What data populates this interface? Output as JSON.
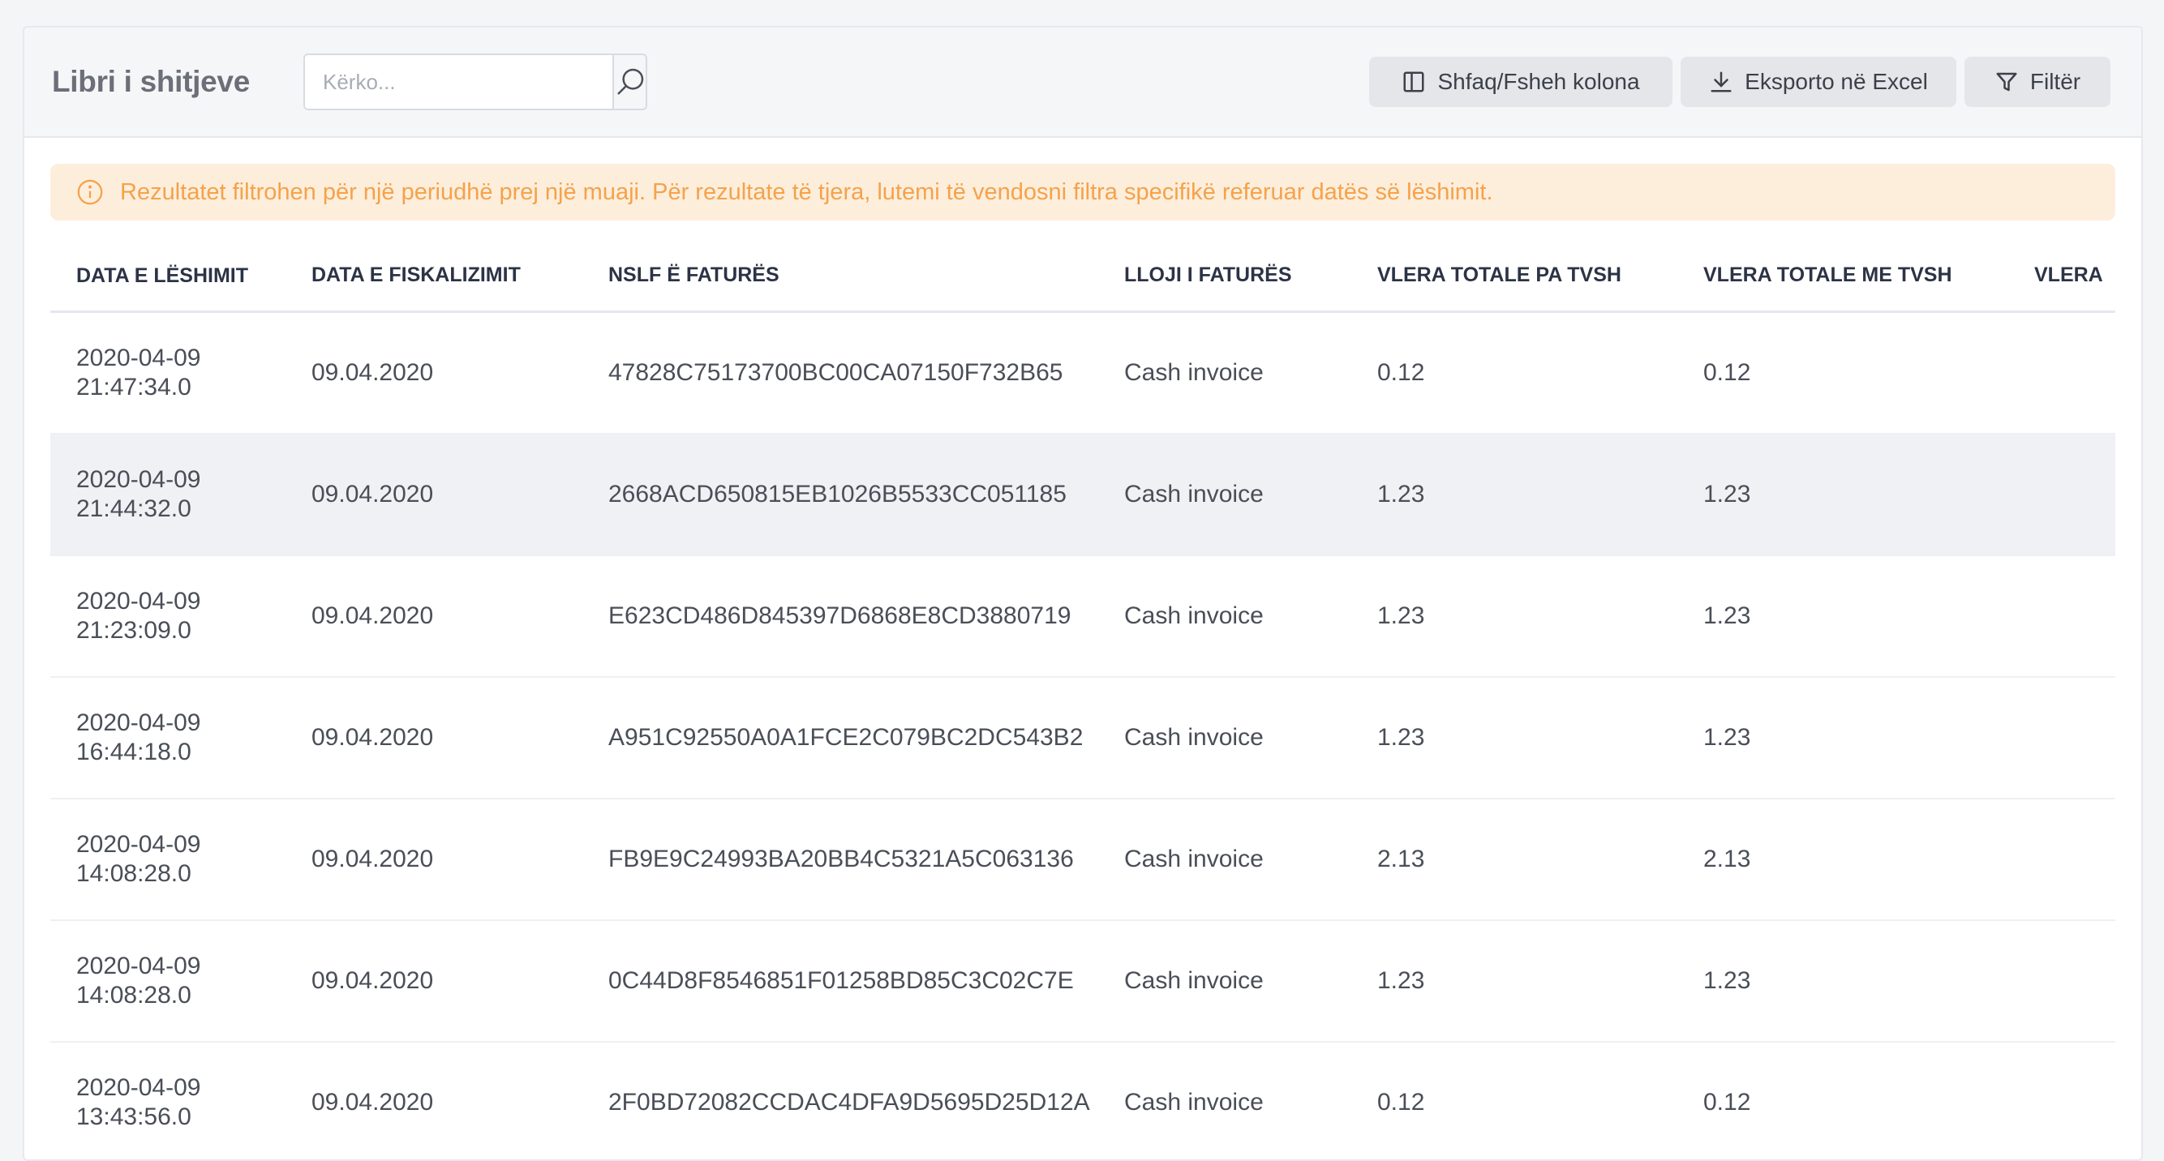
{
  "header": {
    "title": "Libri i shitjeve",
    "search_placeholder": "Kërko...",
    "buttons": {
      "columns": "Shfaq/Fsheh kolona",
      "export": "Eksporto në Excel",
      "filter": "Filtër"
    }
  },
  "alert": {
    "text": "Rezultatet filtrohen për një periudhë prej një muaji. Për rezultate të tjera, lutemi të vendosni filtra specifikë referuar datës së lëshimit.",
    "color": "#f5a24a"
  },
  "table": {
    "columns": [
      "DATA E LËSHIMIT",
      "DATA E FISKALIZIMIT",
      "NSLF Ë FATURËS",
      "LLOJI I FATURËS",
      "VLERA TOTALE PA TVSH",
      "VLERA TOTALE ME TVSH",
      "VLERA"
    ],
    "rows": [
      {
        "issue_date": "2020-04-09",
        "issue_time": "21:47:34.0",
        "fiscal_date": "09.04.2020",
        "nslf": "47828C75173700BC00CA07150F732B65",
        "type": "Cash invoice",
        "total_no_vat": "0.12",
        "total_with_vat": "0.12"
      },
      {
        "issue_date": "2020-04-09",
        "issue_time": "21:44:32.0",
        "fiscal_date": "09.04.2020",
        "nslf": "2668ACD650815EB1026B5533CC051185",
        "type": "Cash invoice",
        "total_no_vat": "1.23",
        "total_with_vat": "1.23"
      },
      {
        "issue_date": "2020-04-09",
        "issue_time": "21:23:09.0",
        "fiscal_date": "09.04.2020",
        "nslf": "E623CD486D845397D6868E8CD3880719",
        "type": "Cash invoice",
        "total_no_vat": "1.23",
        "total_with_vat": "1.23"
      },
      {
        "issue_date": "2020-04-09",
        "issue_time": "16:44:18.0",
        "fiscal_date": "09.04.2020",
        "nslf": "A951C92550A0A1FCE2C079BC2DC543B2",
        "type": "Cash invoice",
        "total_no_vat": "1.23",
        "total_with_vat": "1.23"
      },
      {
        "issue_date": "2020-04-09",
        "issue_time": "14:08:28.0",
        "fiscal_date": "09.04.2020",
        "nslf": "FB9E9C24993BA20BB4C5321A5C063136",
        "type": "Cash invoice",
        "total_no_vat": "2.13",
        "total_with_vat": "2.13"
      },
      {
        "issue_date": "2020-04-09",
        "issue_time": "14:08:28.0",
        "fiscal_date": "09.04.2020",
        "nslf": "0C44D8F8546851F01258BD85C3C02C7E",
        "type": "Cash invoice",
        "total_no_vat": "1.23",
        "total_with_vat": "1.23"
      },
      {
        "issue_date": "2020-04-09",
        "issue_time": "13:43:56.0",
        "fiscal_date": "09.04.2020",
        "nslf": "2F0BD72082CCDAC4DFA9D5695D25D12A",
        "type": "Cash invoice",
        "total_no_vat": "0.12",
        "total_with_vat": "0.12"
      }
    ]
  },
  "icons": {
    "search": "search-icon",
    "columns": "columns-icon",
    "export": "download-icon",
    "filter": "filter-icon",
    "alert": "info-icon"
  }
}
